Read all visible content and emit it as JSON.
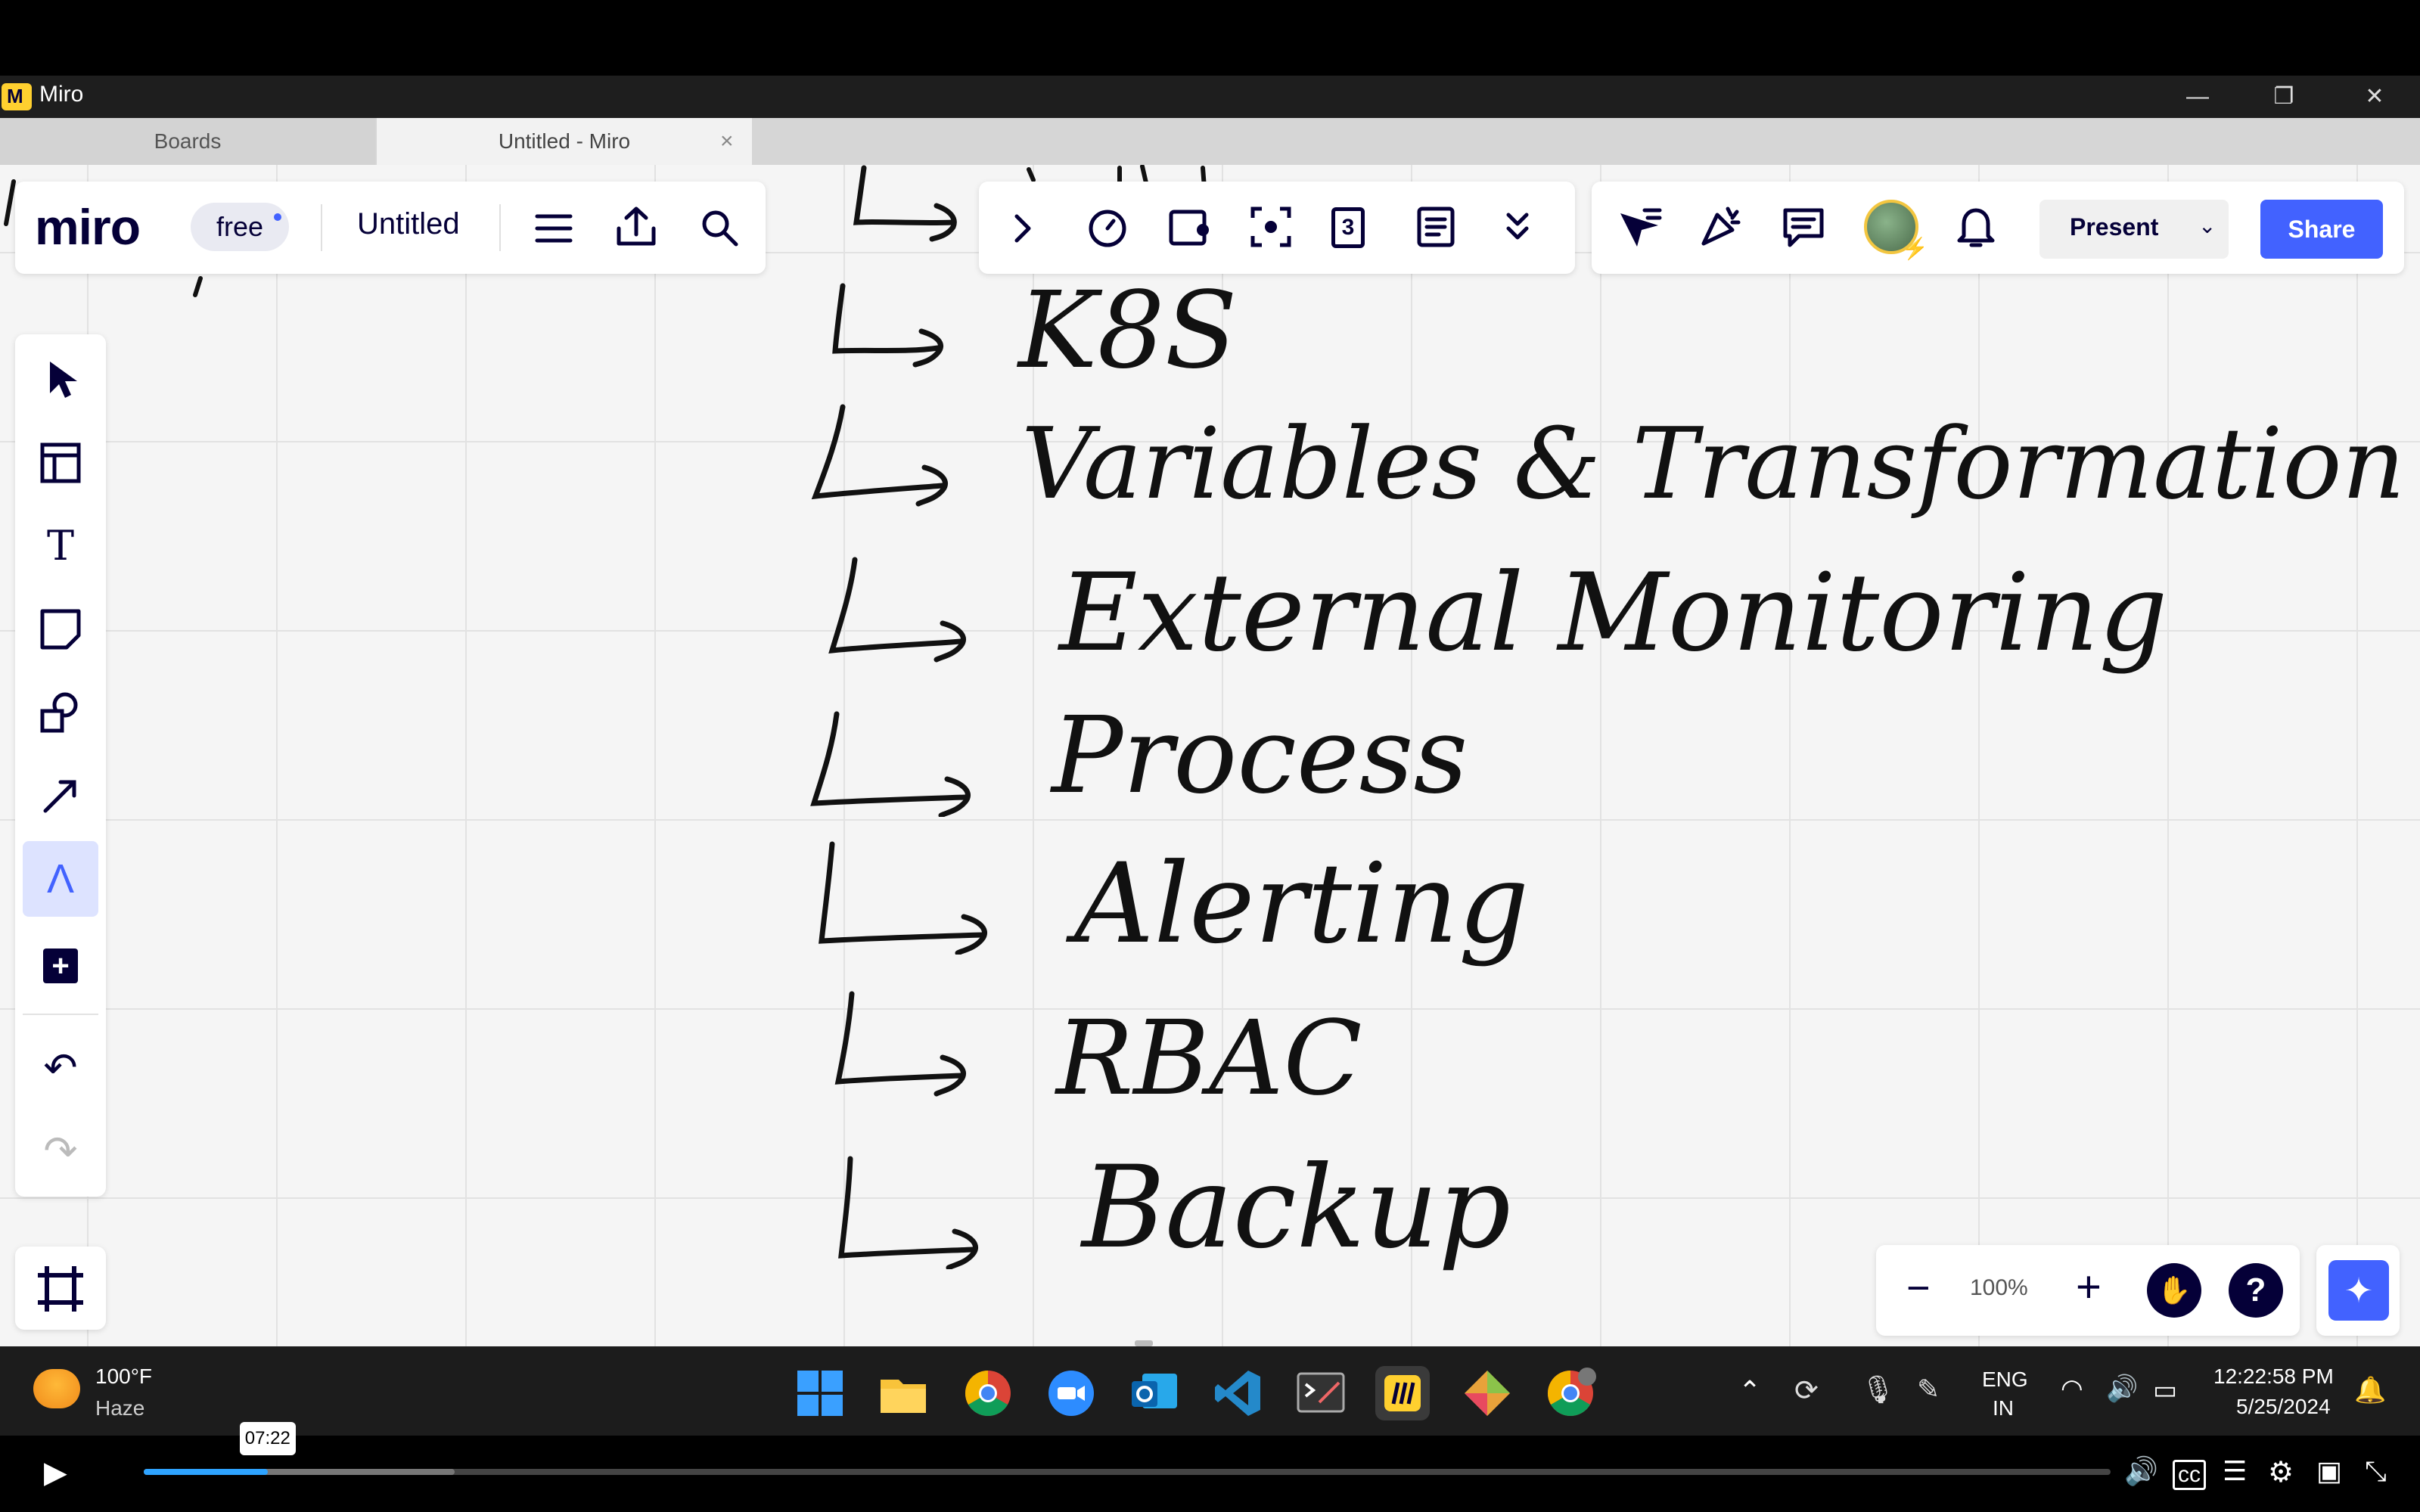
{
  "window": {
    "app_title": "Miro",
    "minimize_glyph": "—",
    "restore_glyph": "❐",
    "close_glyph": "✕"
  },
  "tabs": [
    {
      "label": "Boards"
    },
    {
      "label": "Untitled - Miro",
      "active": true
    }
  ],
  "tab_close_glyph": "×",
  "toolbar_left": {
    "logo": "miro",
    "plan_badge": "free",
    "board_name": "Untitled",
    "icons": [
      "menu-icon",
      "export-icon",
      "search-icon"
    ]
  },
  "toolbar_center": {
    "icons": [
      "expand-chevron-icon",
      "timer-icon",
      "card-icon",
      "focus-frame-icon",
      "counter-icon",
      "notes-icon",
      "collapse-icon"
    ],
    "counter_value": "3"
  },
  "toolbar_right": {
    "icons": [
      "cursor-share-icon",
      "reactions-icon",
      "comments-icon",
      "avatar",
      "bell-icon"
    ],
    "present_label": "Present",
    "share_label": "Share"
  },
  "left_tools": [
    {
      "name": "select",
      "glyph": "➤"
    },
    {
      "name": "templates",
      "glyph": "▣"
    },
    {
      "name": "text",
      "glyph": "T"
    },
    {
      "name": "sticky-note",
      "glyph": "◪"
    },
    {
      "name": "shapes",
      "glyph": "◇"
    },
    {
      "name": "connection-line",
      "glyph": "↗"
    },
    {
      "name": "pen",
      "glyph": "Λ",
      "active": true
    },
    {
      "name": "more-apps",
      "glyph": "+"
    },
    {
      "name": "undo",
      "glyph": "↶"
    },
    {
      "name": "redo",
      "glyph": "↷"
    }
  ],
  "canvas_handwriting": [
    {
      "text": "K8S"
    },
    {
      "text": "Variables & Transformation"
    },
    {
      "text": "External Monitoring"
    },
    {
      "text": "Process"
    },
    {
      "text": "Alerting"
    },
    {
      "text": "RBAC"
    },
    {
      "text": "Backup"
    }
  ],
  "zoom": {
    "minus": "−",
    "value": "100%",
    "plus": "+",
    "hand_glyph": "✋",
    "help_glyph": "?"
  },
  "ai_glyph": "✦",
  "taskbar": {
    "weather_temp": "100°F",
    "weather_desc": "Haze",
    "language_top": "ENG",
    "language_bottom": "IN",
    "time": "12:22:58 PM",
    "date": "5/25/2024",
    "apps": [
      "start",
      "file-explorer",
      "chrome",
      "zoom",
      "outlook",
      "vscode",
      "terminal",
      "miro",
      "git",
      "chrome-profile"
    ]
  },
  "player": {
    "current_time": "07:22",
    "progress_percent": 6.3,
    "buffered_percent": 15.8,
    "play_glyph": "▶"
  },
  "colors": {
    "miro_yellow": "#ffd02f",
    "miro_blue": "#4262ff",
    "progress": "#2ea3ff"
  }
}
